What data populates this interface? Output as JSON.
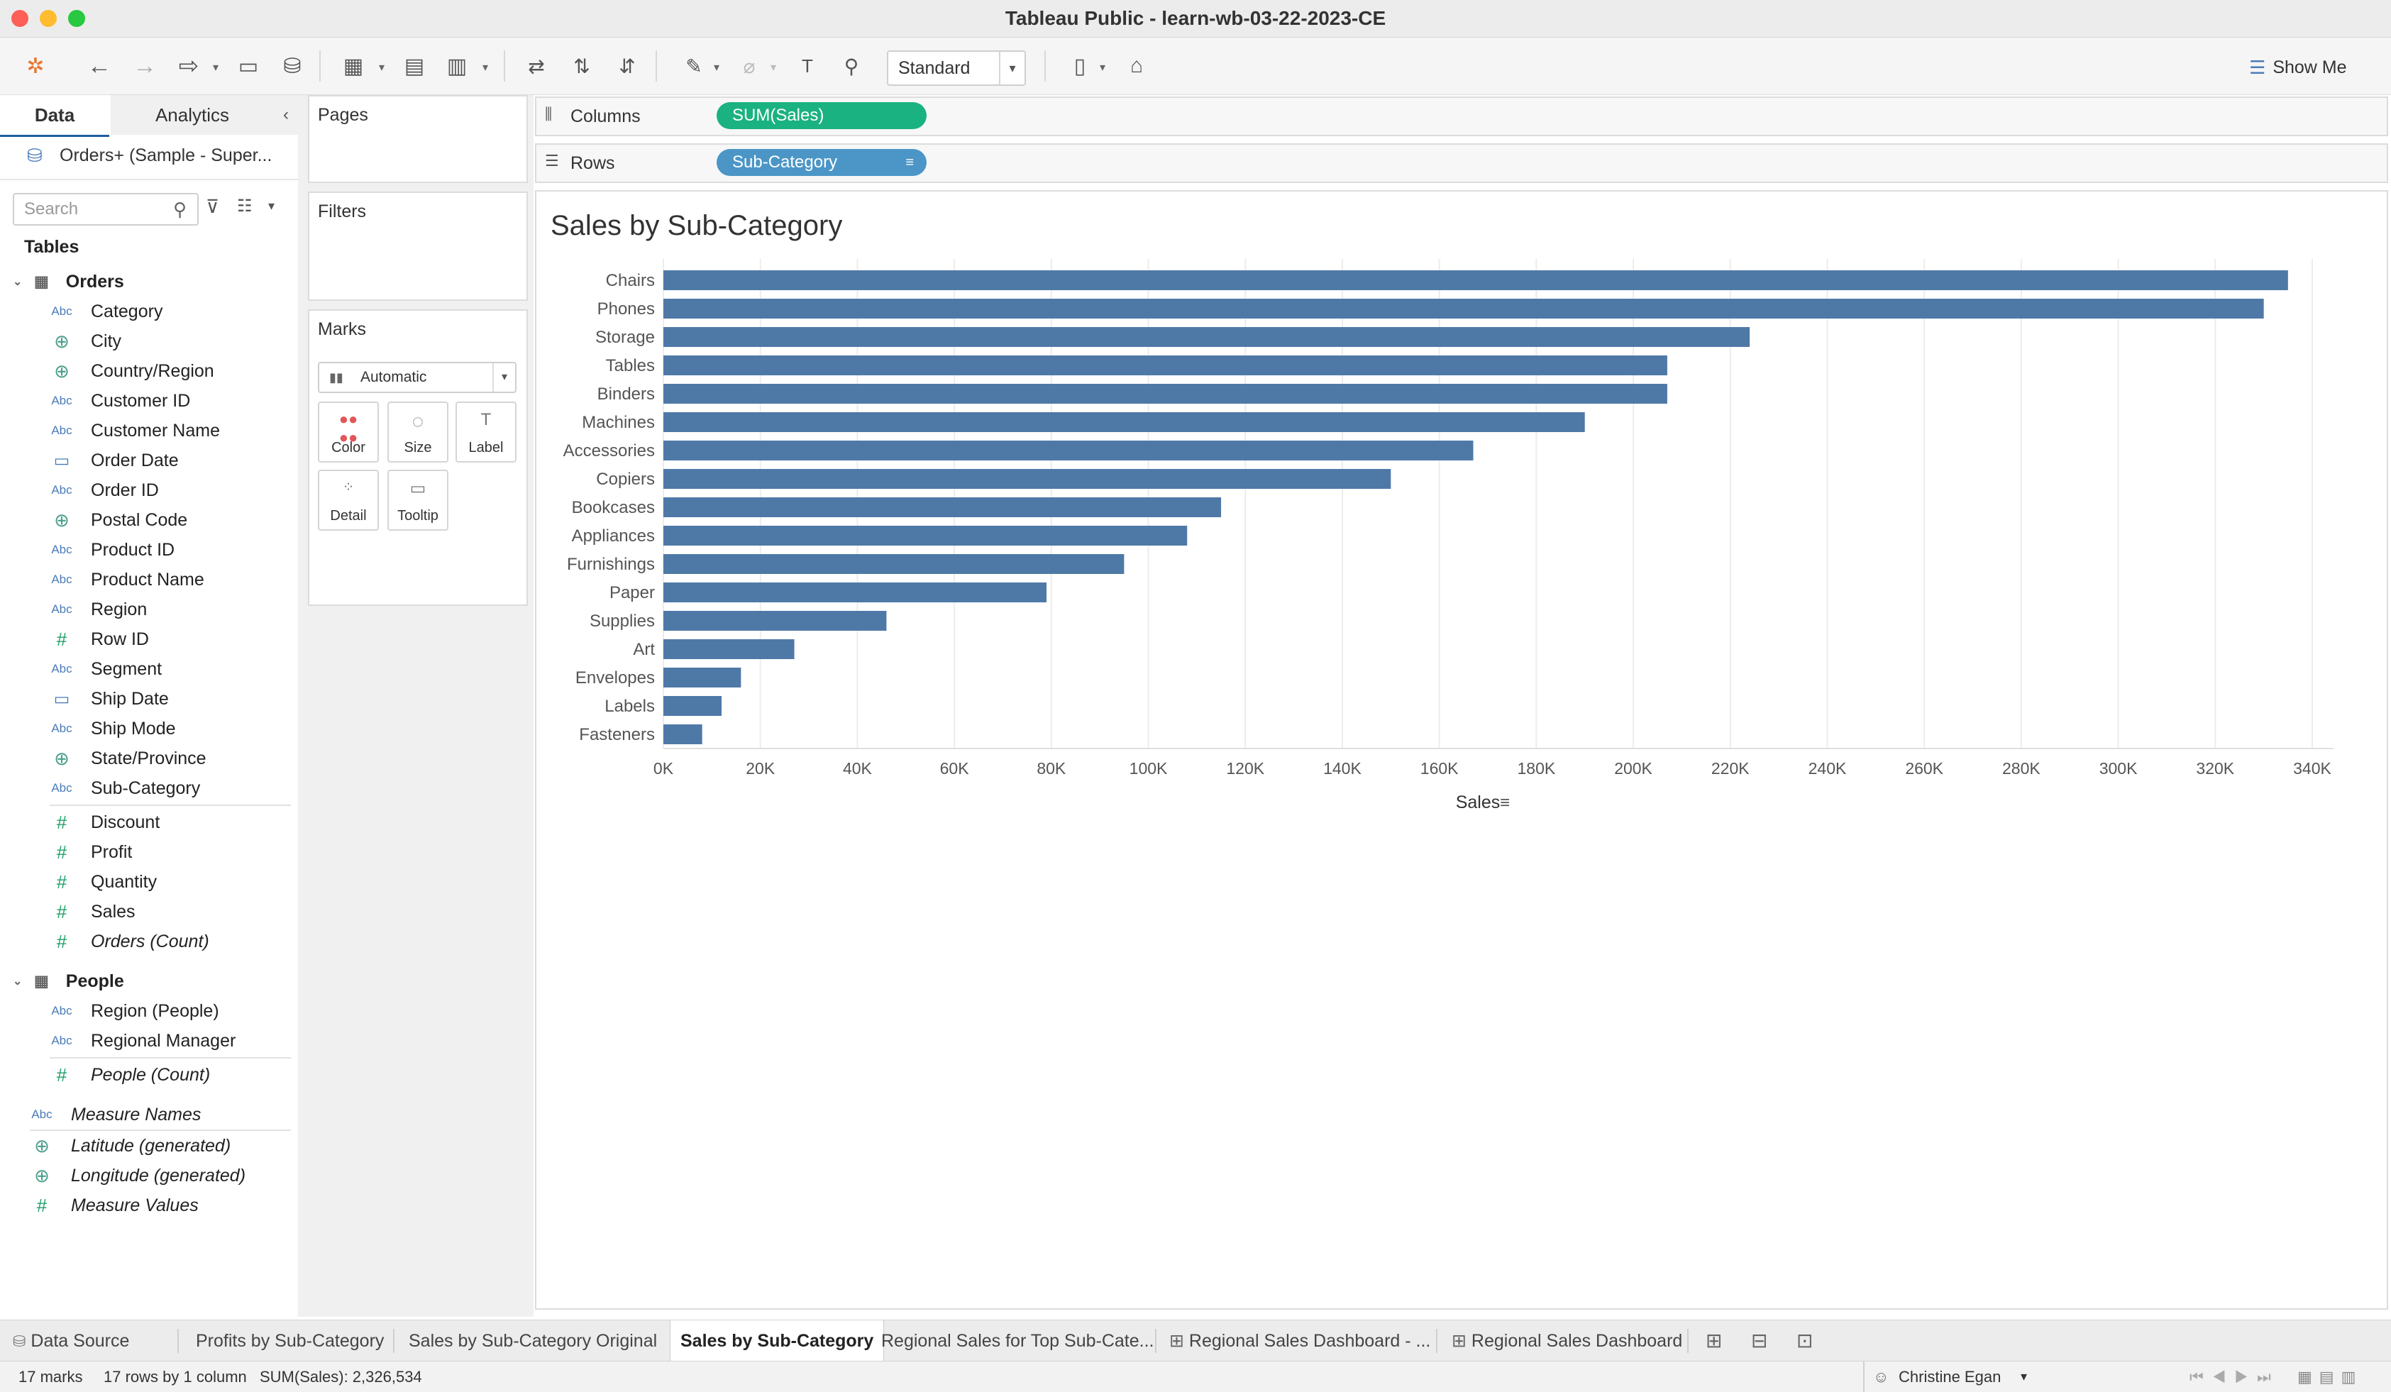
{
  "window": {
    "title": "Tableau Public - learn-wb-03-22-2023-CE"
  },
  "toolbar": {
    "fit_option": "Standard",
    "show_me": "Show Me"
  },
  "side_tabs": {
    "data": "Data",
    "analytics": "Analytics"
  },
  "datasource": {
    "name": "Orders+ (Sample - Super..."
  },
  "search": {
    "placeholder": "Search"
  },
  "tables_title": "Tables",
  "tables": [
    {
      "name": "Orders",
      "fields": [
        {
          "type": "abc",
          "name": "Category"
        },
        {
          "type": "globe",
          "name": "City"
        },
        {
          "type": "globe",
          "name": "Country/Region"
        },
        {
          "type": "abc",
          "name": "Customer ID"
        },
        {
          "type": "abc",
          "name": "Customer Name"
        },
        {
          "type": "calendar",
          "name": "Order Date"
        },
        {
          "type": "abc",
          "name": "Order ID"
        },
        {
          "type": "globe",
          "name": "Postal Code"
        },
        {
          "type": "abc",
          "name": "Product ID"
        },
        {
          "type": "abc",
          "name": "Product Name"
        },
        {
          "type": "abc",
          "name": "Region"
        },
        {
          "type": "hash",
          "name": "Row ID"
        },
        {
          "type": "abc",
          "name": "Segment"
        },
        {
          "type": "calendar",
          "name": "Ship Date"
        },
        {
          "type": "abc",
          "name": "Ship Mode"
        },
        {
          "type": "globe",
          "name": "State/Province"
        },
        {
          "type": "abc",
          "name": "Sub-Category"
        }
      ],
      "measures": [
        {
          "type": "hash",
          "name": "Discount"
        },
        {
          "type": "hash",
          "name": "Profit"
        },
        {
          "type": "hash",
          "name": "Quantity"
        },
        {
          "type": "hash",
          "name": "Sales"
        },
        {
          "type": "hash",
          "name": "Orders (Count)",
          "italic": true
        }
      ]
    },
    {
      "name": "People",
      "fields": [
        {
          "type": "abc",
          "name": "Region (People)"
        },
        {
          "type": "abc",
          "name": "Regional Manager"
        }
      ],
      "measures": [
        {
          "type": "hash",
          "name": "People (Count)",
          "italic": true
        }
      ]
    }
  ],
  "generated_fields": [
    {
      "type": "abc",
      "name": "Measure Names"
    },
    {
      "type": "globe",
      "name": "Latitude (generated)"
    },
    {
      "type": "globe",
      "name": "Longitude (generated)"
    },
    {
      "type": "hash",
      "name": "Measure Values"
    }
  ],
  "cards": {
    "pages": "Pages",
    "filters": "Filters",
    "marks": "Marks",
    "mark_type": "Automatic"
  },
  "mark_buttons": {
    "color": "Color",
    "size": "Size",
    "label": "Label",
    "detail": "Detail",
    "tooltip": "Tooltip"
  },
  "shelves": {
    "columns_label": "Columns",
    "columns_pill": "SUM(Sales)",
    "rows_label": "Rows",
    "rows_pill": "Sub-Category"
  },
  "colors": {
    "bar": "#4e79a7",
    "measure_pill": "#1ab280",
    "dimension_pill": "#4b96c6"
  },
  "chart_data": {
    "type": "bar",
    "orientation": "horizontal",
    "title": "Sales by Sub-Category",
    "xlabel": "Sales",
    "ylabel": "",
    "categories": [
      "Chairs",
      "Phones",
      "Storage",
      "Tables",
      "Binders",
      "Machines",
      "Accessories",
      "Copiers",
      "Bookcases",
      "Appliances",
      "Furnishings",
      "Paper",
      "Supplies",
      "Art",
      "Envelopes",
      "Labels",
      "Fasteners"
    ],
    "values": [
      335000,
      330000,
      224000,
      207000,
      207000,
      190000,
      167000,
      150000,
      115000,
      108000,
      95000,
      79000,
      46000,
      27000,
      16000,
      12000,
      8000
    ],
    "xlim": [
      0,
      340000
    ],
    "xticks": [
      "0K",
      "20K",
      "40K",
      "60K",
      "80K",
      "100K",
      "120K",
      "140K",
      "160K",
      "180K",
      "200K",
      "220K",
      "240K",
      "260K",
      "280K",
      "300K",
      "320K",
      "340K"
    ],
    "grid": true
  },
  "sheet_tabs": {
    "data_source": "Data Source",
    "tabs": [
      "Profits by Sub-Category",
      "Sales by Sub-Category Original",
      "Sales by Sub-Category",
      "Regional Sales for Top Sub-Cate...",
      "Regional Sales Dashboard - ...",
      "Regional Sales Dashboard"
    ]
  },
  "status": {
    "marks": "17 marks",
    "dims": "17 rows by 1 column",
    "sum": "SUM(Sales): 2,326,534",
    "user": "Christine Egan"
  }
}
